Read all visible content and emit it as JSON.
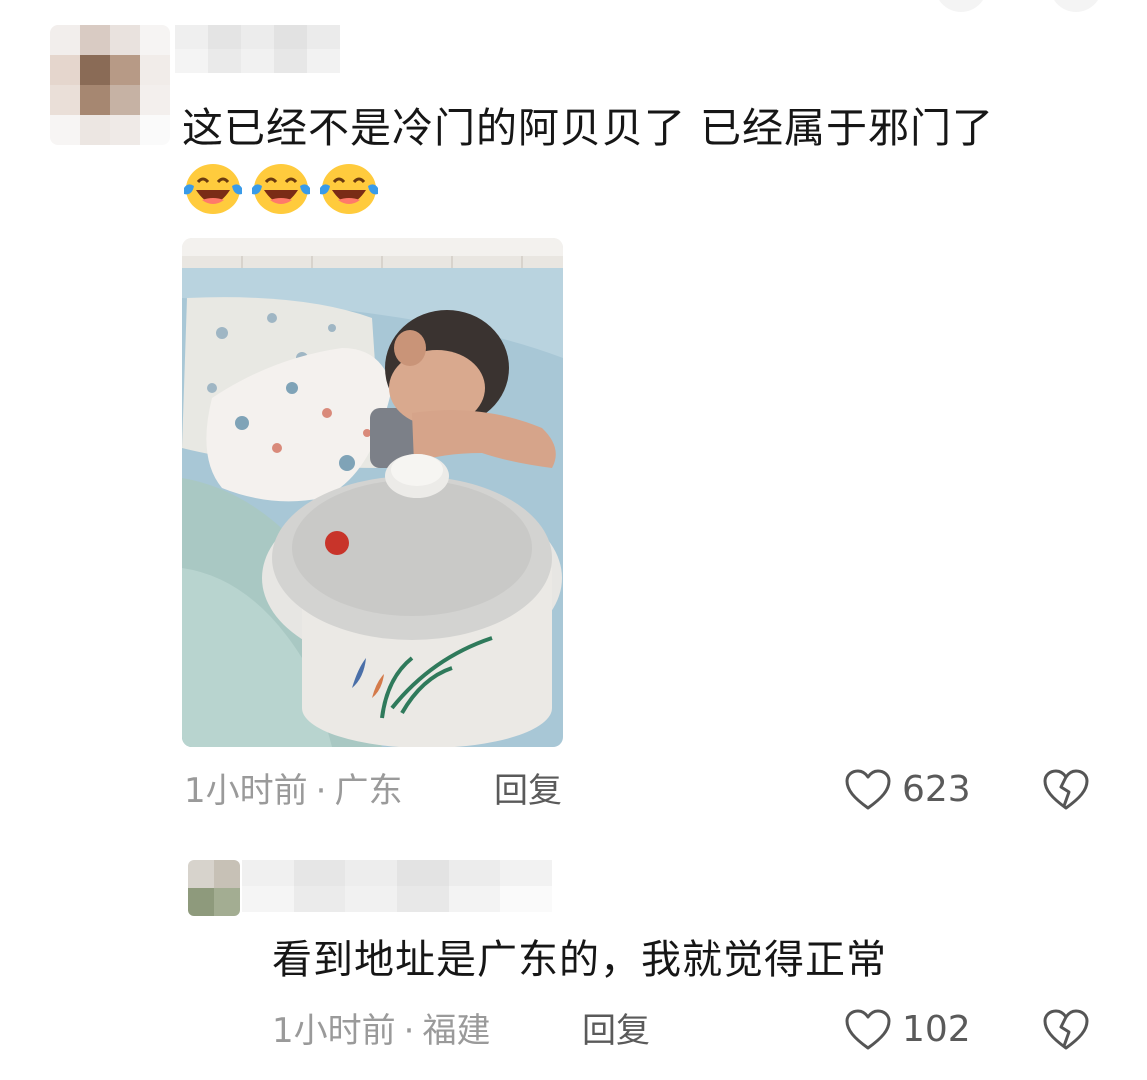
{
  "comment": {
    "text": "这已经不是冷门的阿贝贝了  已经属于邪门了",
    "emojis": [
      "laughing-crying-emoji",
      "laughing-crying-emoji",
      "laughing-crying-emoji"
    ],
    "photo": {
      "alt": "child sleeping hugging a ceramic stew pot"
    },
    "time": "1小时前",
    "location": "广东",
    "reply_label": "回复",
    "likes": "623"
  },
  "reply": {
    "text": "看到地址是广东的，我就觉得正常",
    "time": "1小时前",
    "location": "福建",
    "reply_label": "回复",
    "likes": "102"
  },
  "separator": "·",
  "colors": {
    "meta": "#9a9a9a",
    "text": "#161616",
    "action": "#5a5a5a"
  }
}
